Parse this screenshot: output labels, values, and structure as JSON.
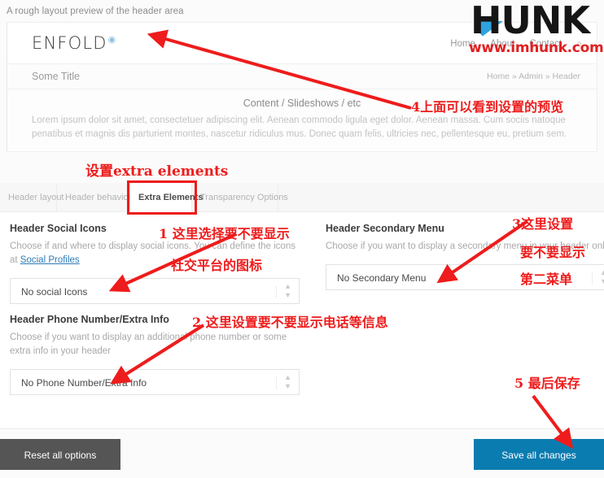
{
  "preview": {
    "caption": "A rough layout preview of the header area",
    "logo": "ENFOLD",
    "logo_mark": "◉",
    "nav": [
      "Home",
      "About",
      "Contact"
    ],
    "search_icon": "⌕",
    "some_title": "Some Title",
    "breadcrumb": "Home » Admin » Header",
    "content_head": "Content / Slideshows / etc",
    "content_body": "Lorem ipsum dolor sit amet, consectetuer adipiscing elit. Aenean commodo ligula eget dolor. Aenean massa. Cum sociis natoque penatibus et magnis dis parturient montes, nascetur ridiculus mus. Donec quam felis, ultricies nec, pellentesque eu, pretium sem."
  },
  "tabs": [
    {
      "label": "Header layout",
      "active": false
    },
    {
      "label": "Header behavior",
      "active": false
    },
    {
      "label": "Extra Elements",
      "active": true
    },
    {
      "label": "Transparency Options",
      "active": false
    }
  ],
  "fields": {
    "social": {
      "title": "Header Social Icons",
      "desc_pre": "Choose if and where to display social icons. You can define the icons at ",
      "desc_link": "Social Profiles",
      "value": "No social Icons"
    },
    "secondary_menu": {
      "title": "Header Secondary Menu",
      "desc": "Choose if you want to display a secondary menu in your header only",
      "value": "No Secondary Menu"
    },
    "phone": {
      "title": "Header Phone Number/Extra Info",
      "desc": "Choose if you want to display an additional phone number or some extra info in your header",
      "value": "No Phone Number/Extra Info"
    }
  },
  "footer": {
    "reset_label": "Reset all options",
    "save_label": "Save all changes"
  },
  "watermark": {
    "brand": "HUNK",
    "url": "www.imhunk.com"
  },
  "annotations": {
    "a0": "设置extra elements",
    "a1_line1": "1 这里选择要不要显示",
    "a1_line2": "社交平台的图标",
    "a2": "2  这里设置要不要显示电话等信息",
    "a3_line1": "3这里设置",
    "a3_line2": "要不要显示",
    "a3_line3": "第二菜单",
    "a4": "4上面可以看到设置的预览",
    "a5": "5  最后保存"
  },
  "colors": {
    "annotation_red": "#ee1c1c",
    "save_blue": "#0b7cb0",
    "reset_gray": "#555555",
    "link_blue": "#2b7bb9"
  }
}
